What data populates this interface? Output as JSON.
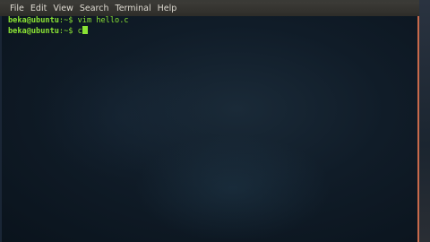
{
  "menubar": {
    "items": [
      "File",
      "Edit",
      "View",
      "Search",
      "Terminal",
      "Help"
    ]
  },
  "terminal": {
    "lines": [
      {
        "prompt": "beka@ubuntu",
        "path": ":~$",
        "command": " vim hello.c"
      },
      {
        "prompt": "beka@ubuntu",
        "path": ":~$",
        "command": " c"
      }
    ]
  },
  "colors": {
    "prompt": "#8ae234",
    "menubar_bg": "#3c3b37",
    "terminal_bg": "#0d1823",
    "border_accent": "#c86a4c"
  }
}
